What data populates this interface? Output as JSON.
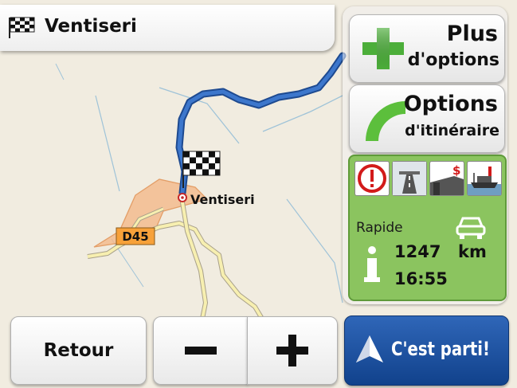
{
  "destination": {
    "name": "Ventiseri",
    "flag_icon": "checkered-flag-icon"
  },
  "map": {
    "place_label": "Ventiseri",
    "road_label": "D45",
    "colors": {
      "route": "#2c5fb4",
      "road": "#f7efb0",
      "area": "#f4b98a",
      "background": "#f1ece0"
    }
  },
  "panel": {
    "more_options": {
      "line1": "Plus",
      "line2": "d'options",
      "icon": "plus-icon"
    },
    "route_options": {
      "line1": "Options",
      "line2": "d'itinéraire",
      "icon": "arc-icon"
    },
    "route_icons": [
      "warning-icon",
      "highway-icon",
      "toll-road-icon",
      "ferry-icon"
    ],
    "route_info": {
      "mode": "Rapide",
      "vehicle_icon": "car-icon",
      "distance_value": "1247",
      "distance_unit": "km",
      "time": "16:55"
    }
  },
  "bottom": {
    "back_label": "Retour",
    "zoom_out_icon": "minus-icon",
    "zoom_in_icon": "plus-icon",
    "go_label": "C'est parti!"
  }
}
